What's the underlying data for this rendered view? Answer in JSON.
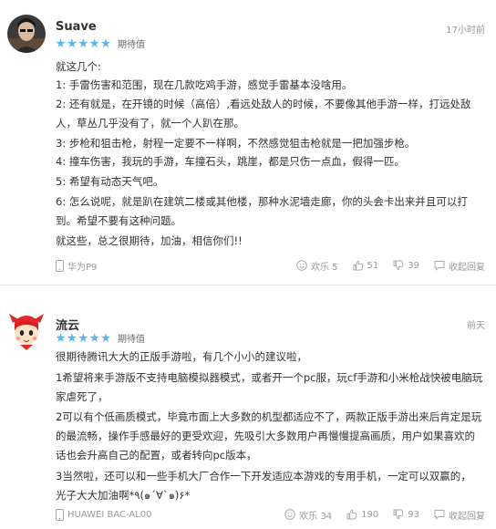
{
  "reviews": [
    {
      "username": "Suave",
      "time": "17小时前",
      "rating_label": "期待值",
      "rating": 5,
      "paragraphs": [
        "就这几个:",
        "1: 手雷伤害和范围，现在几款吃鸡手游，感觉手雷基本没啥用。",
        "2: 还有就是，在开镜的时候（高倍）,看远处敌人的时候，不要像其他手游一样，打远处敌人，草丛几乎没有了，就一个人趴在那。",
        "3: 步枪和狙击枪，射程一定要不一样啊，不然感觉狙击枪就是一把加强步枪。",
        "4: 撞车伤害，我玩的手游，车撞石头，跳崖，都是只伤一点血，假得一匹。",
        "5: 希望有动态天气吧。",
        "6: 怎么说呢，就是趴在建筑二楼或其他楼，那种水泥墙走廊，你的头会卡出来并且可以打到。希望不要有这种问题。",
        "就这些，总之很期待，加油，相信你们!!"
      ],
      "device": "华为P9",
      "fun_label": "欢乐 5",
      "likes": "51",
      "dislikes": "39",
      "reply_label": "收起回复"
    },
    {
      "username": "流云",
      "time": "前天",
      "rating_label": "期待值",
      "rating": 5,
      "paragraphs": [
        "很期待腾讯大大的正版手游啦，有几个小小的建议啦，",
        "1希望将来手游版不支持电脑模拟器模式，或者开一个pc服，玩cf手游和小米枪战快被电脑玩家虐死了，",
        "2可以有个低画质模式，毕竟市面上大多数的机型都适应不了，两款正版手游出来后肯定是玩的最流畅，操作手感最好的更受欢迎，先吸引大多数用户再慢慢提高画质，用户如果喜欢的话也会升高自己的配置，或者转向pc版本，",
        "3当然啦，还可以和一些手机大厂合作一下开发适应本游戏的专用手机，一定可以双赢的，",
        "光子大大加油啊*٩(๑´∀`๑)۶*"
      ],
      "device": "HUAWEI BAC-AL00",
      "fun_label": "欢乐 34",
      "likes": "190",
      "dislikes": "93",
      "reply_label": "收起回复"
    }
  ],
  "colors": {
    "star": "#5bb8ea",
    "muted": "#999999",
    "text": "#333333",
    "divider": "#e6e6e6"
  },
  "icons": [
    "phone-icon",
    "smiley-icon",
    "thumbs-up-icon",
    "thumbs-down-icon",
    "comment-icon"
  ]
}
